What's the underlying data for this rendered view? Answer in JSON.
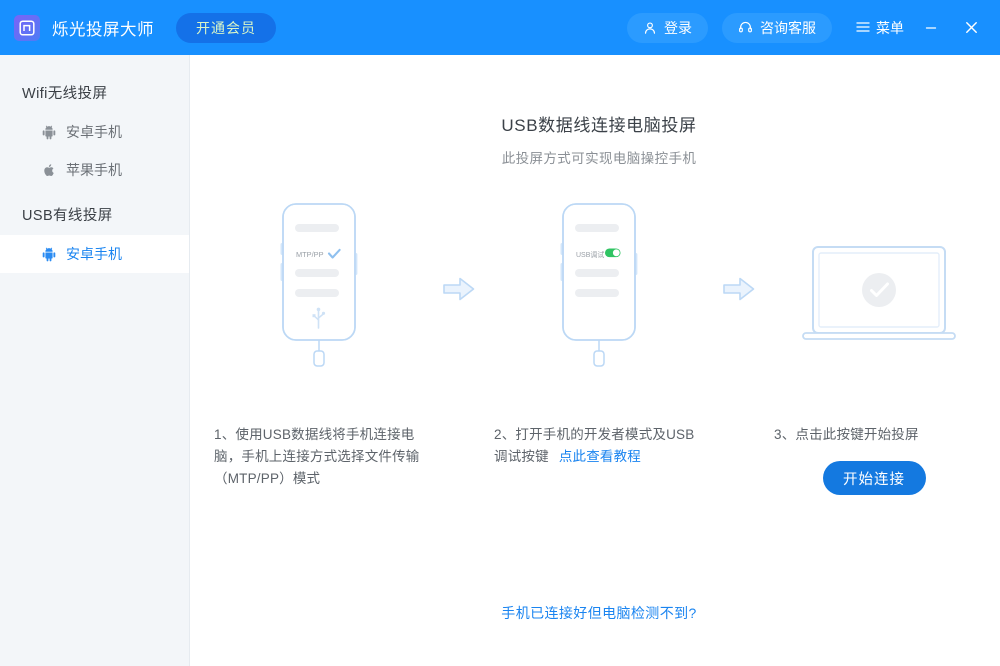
{
  "titlebar": {
    "logo_icon": "app-logo-icon",
    "app_title": "烁光投屏大师",
    "vip_button": "开通会员",
    "login_button": "登录",
    "login_icon": "user-icon",
    "support_button": "咨询客服",
    "support_icon": "headset-icon",
    "menu_label": "菜单",
    "menu_icon": "hamburger-icon",
    "minimize_icon": "minimize-icon",
    "close_icon": "close-icon",
    "bg_color": "#1890ff",
    "vip_bg_color": "#1471e8",
    "vip_text_color": "#d8f5c8"
  },
  "sidebar": {
    "bg_color": "#f3f6f9",
    "groups": [
      {
        "label": "Wifi无线投屏",
        "items": [
          {
            "label": "安卓手机",
            "icon": "android-icon",
            "active": false
          },
          {
            "label": "苹果手机",
            "icon": "apple-icon",
            "active": false
          }
        ]
      },
      {
        "label": "USB有线投屏",
        "items": [
          {
            "label": "安卓手机",
            "icon": "android-icon",
            "active": true
          }
        ]
      }
    ],
    "active_color": "#1a84f0"
  },
  "main": {
    "title": "USB数据线连接电脑投屏",
    "subtitle": "此投屏方式可实现电脑操控手机",
    "steps": [
      {
        "text": "1、使用USB数据线将手机连接电脑，手机上连接方式选择文件传输（MTP/PP）模式",
        "art": "phone-mtp",
        "phone_option_label": "MTP/PP",
        "phone_option_state": "check",
        "phone_bottom_icon": "usb-icon"
      },
      {
        "text": "2、打开手机的开发者模式及USB调试按键",
        "link_text": "点此查看教程",
        "art": "phone-usb-debug",
        "phone_option_label": "USB调试",
        "phone_option_state": "toggle-on",
        "toggle_color": "#30c463"
      },
      {
        "text": "3、点击此按键开始投屏",
        "art": "laptop-check",
        "button_label": "开始连接",
        "button_color": "#1479e0"
      }
    ],
    "arrow_icon": "arrow-right-icon",
    "bottom_link": "手机已连接好但电脑检测不到?",
    "link_color": "#1a84f0"
  }
}
